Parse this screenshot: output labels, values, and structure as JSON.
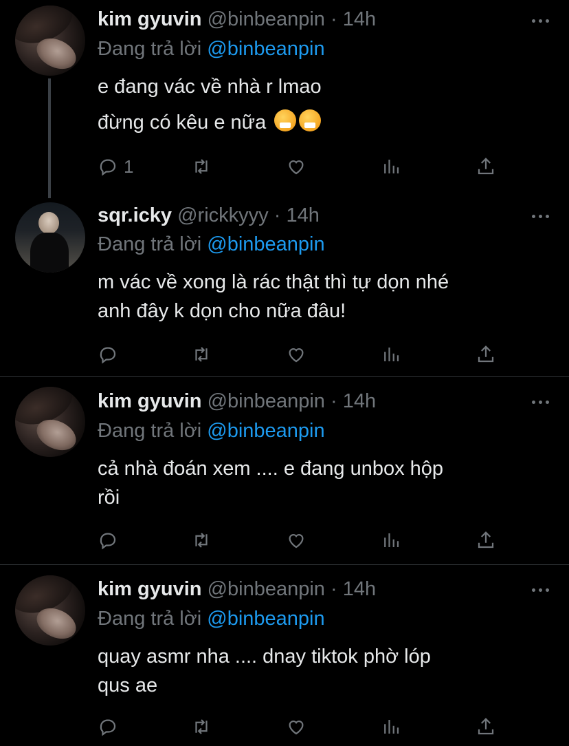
{
  "tweets": [
    {
      "name": "kim gyuvin",
      "handle": "@binbeanpin",
      "sep": "·",
      "time": "14h",
      "reply_prefix": "Đang trả lời",
      "reply_to": "@binbeanpin",
      "lines": [
        "e đang vác về nhà r lmao",
        "đừng có kêu e nữa"
      ],
      "emojis": [
        "face-with-steam-emoji",
        "face-with-steam-emoji"
      ],
      "reply_count": "1"
    },
    {
      "name": "sqr.icky",
      "handle": "@rickkyyy",
      "sep": "·",
      "time": "14h",
      "reply_prefix": "Đang trả lời",
      "reply_to": "@binbeanpin",
      "lines": [
        "m vác về xong là rác thật thì tự dọn nhé",
        "anh đây k dọn cho nữa đâu!"
      ]
    },
    {
      "name": "kim gyuvin",
      "handle": "@binbeanpin",
      "sep": "·",
      "time": "14h",
      "reply_prefix": "Đang trả lời",
      "reply_to": "@binbeanpin",
      "lines": [
        "cả nhà đoán xem .... e đang unbox hộp",
        "rồi"
      ]
    },
    {
      "name": "kim gyuvin",
      "handle": "@binbeanpin",
      "sep": "·",
      "time": "14h",
      "reply_prefix": "Đang trả lời",
      "reply_to": "@binbeanpin",
      "lines": [
        "quay asmr nha .... dnay tiktok phờ lóp",
        "qus ae"
      ]
    }
  ],
  "colors": {
    "background": "#000000",
    "text": "#e7e9ea",
    "muted": "#71767b",
    "accent": "#1d9bf0",
    "divider": "#2f3336"
  }
}
